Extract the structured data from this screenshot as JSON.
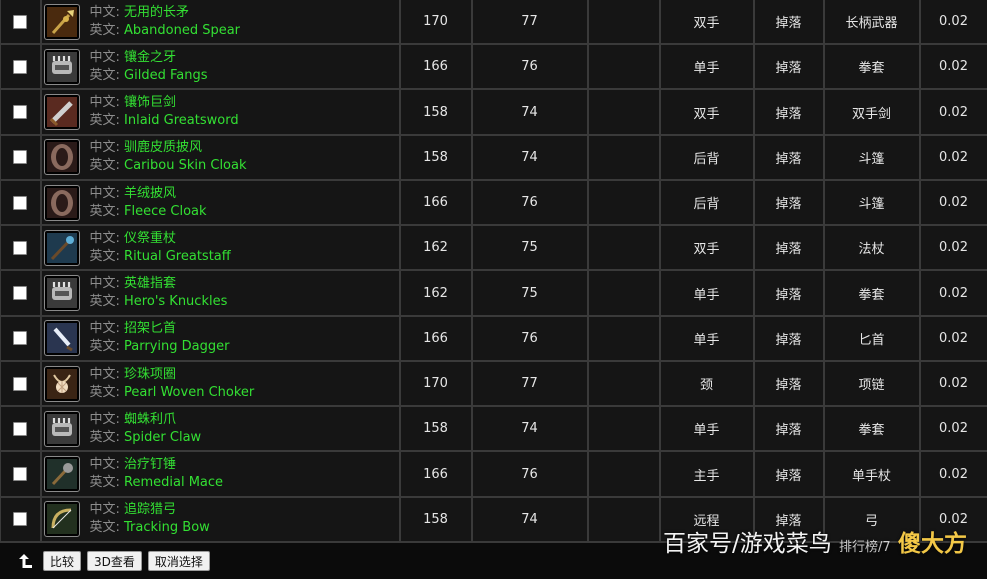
{
  "labels": {
    "zh": "中文:",
    "en": "英文:"
  },
  "items": [
    {
      "icon": "spear-icon",
      "zh": "无用的长矛",
      "en": "Abandoned Spear",
      "item_level": "170",
      "req_level": "77",
      "blank": "",
      "slot": "双手",
      "source": "掉落",
      "type": "长柄武器",
      "rate": "0.02"
    },
    {
      "icon": "fist-weapon-icon",
      "zh": "镶金之牙",
      "en": "Gilded Fangs",
      "item_level": "166",
      "req_level": "76",
      "blank": "",
      "slot": "单手",
      "source": "掉落",
      "type": "拳套",
      "rate": "0.02"
    },
    {
      "icon": "greatsword-icon",
      "zh": "镶饰巨剑",
      "en": "Inlaid Greatsword",
      "item_level": "158",
      "req_level": "74",
      "blank": "",
      "slot": "双手",
      "source": "掉落",
      "type": "双手剑",
      "rate": "0.02"
    },
    {
      "icon": "cloak-icon",
      "zh": "驯鹿皮质披风",
      "en": "Caribou Skin Cloak",
      "item_level": "158",
      "req_level": "74",
      "blank": "",
      "slot": "后背",
      "source": "掉落",
      "type": "斗篷",
      "rate": "0.02"
    },
    {
      "icon": "cloak-icon",
      "zh": "羊绒披风",
      "en": "Fleece Cloak",
      "item_level": "166",
      "req_level": "76",
      "blank": "",
      "slot": "后背",
      "source": "掉落",
      "type": "斗篷",
      "rate": "0.02"
    },
    {
      "icon": "staff-icon",
      "zh": "仪祭重杖",
      "en": "Ritual Greatstaff",
      "item_level": "162",
      "req_level": "75",
      "blank": "",
      "slot": "双手",
      "source": "掉落",
      "type": "法杖",
      "rate": "0.02"
    },
    {
      "icon": "fist-weapon-icon",
      "zh": "英雄指套",
      "en": "Hero's Knuckles",
      "item_level": "162",
      "req_level": "75",
      "blank": "",
      "slot": "单手",
      "source": "掉落",
      "type": "拳套",
      "rate": "0.02"
    },
    {
      "icon": "dagger-icon",
      "zh": "招架匕首",
      "en": "Parrying Dagger",
      "item_level": "166",
      "req_level": "76",
      "blank": "",
      "slot": "单手",
      "source": "掉落",
      "type": "匕首",
      "rate": "0.02"
    },
    {
      "icon": "necklace-icon",
      "zh": "珍珠项圈",
      "en": "Pearl Woven Choker",
      "item_level": "170",
      "req_level": "77",
      "blank": "",
      "slot": "颈",
      "source": "掉落",
      "type": "项链",
      "rate": "0.02"
    },
    {
      "icon": "fist-weapon-icon",
      "zh": "蜘蛛利爪",
      "en": "Spider Claw",
      "item_level": "158",
      "req_level": "74",
      "blank": "",
      "slot": "单手",
      "source": "掉落",
      "type": "拳套",
      "rate": "0.02"
    },
    {
      "icon": "mace-icon",
      "zh": "治疗钉锤",
      "en": "Remedial Mace",
      "item_level": "166",
      "req_level": "76",
      "blank": "",
      "slot": "主手",
      "source": "掉落",
      "type": "单手杖",
      "rate": "0.02"
    },
    {
      "icon": "bow-icon",
      "zh": "追踪猎弓",
      "en": "Tracking Bow",
      "item_level": "158",
      "req_level": "74",
      "blank": "",
      "slot": "远程",
      "source": "掉落",
      "type": "弓",
      "rate": "0.02"
    }
  ],
  "toolbar": {
    "up_icon": "return-arrow-icon",
    "compare": "比较",
    "view3d": "3D查看",
    "cancel": "取消选择"
  },
  "watermark": {
    "text": "百家号/游戏菜鸟",
    "overlap_text": "排行榜/7",
    "logo_text": "傻大方"
  },
  "colors": {
    "name_green": "#33e033",
    "label_gray": "#8d8d8d",
    "background": "#151515",
    "grid_line": "#3a3a3a"
  }
}
